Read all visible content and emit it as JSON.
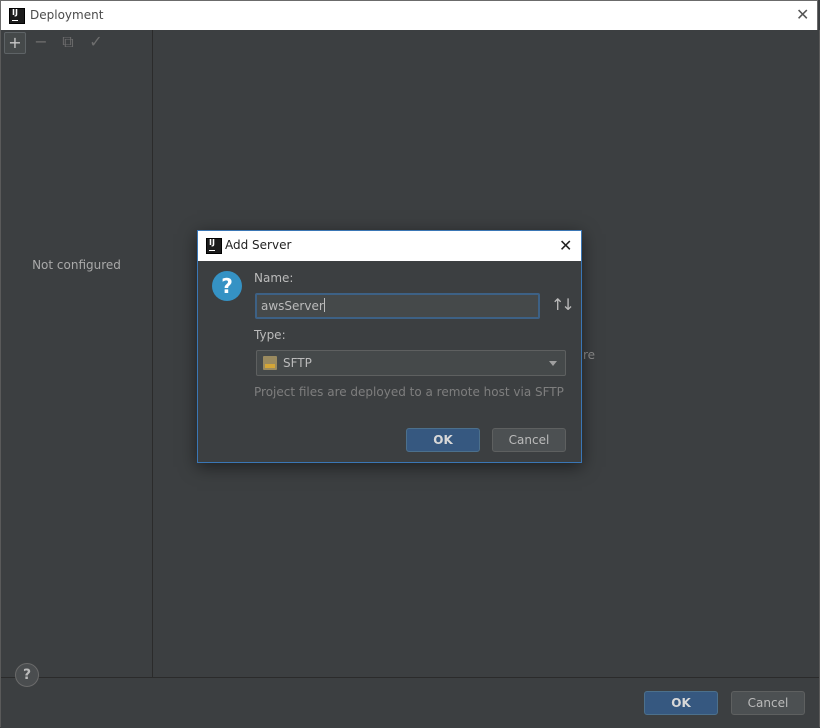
{
  "window": {
    "title": "Deployment"
  },
  "toolbar": {
    "add": "+",
    "remove": "−",
    "copy": "⧉",
    "check": "✓"
  },
  "left_panel": {
    "empty_text": "Not configured"
  },
  "right_panel": {
    "hidden_fragment": "re"
  },
  "footer": {
    "help": "?",
    "ok_label": "OK",
    "cancel_label": "Cancel"
  },
  "dialog": {
    "title": "Add Server",
    "name_label": "Name:",
    "name_value": "awsServer",
    "type_label": "Type:",
    "type_value": "SFTP",
    "description": "Project files are deployed to a remote host via SFTP",
    "ok_label": "OK",
    "cancel_label": "Cancel"
  },
  "colors": {
    "background": "#3c3f41",
    "accent": "#365880",
    "dialog_border": "#3a76b5",
    "help_icon": "#3592c4"
  },
  "icons": [
    "app-logo",
    "close-icon",
    "add-icon",
    "remove-icon",
    "copy-icon",
    "check-icon",
    "question-icon",
    "sort-icon",
    "sftp-icon",
    "chevron-down-icon",
    "help-icon"
  ]
}
